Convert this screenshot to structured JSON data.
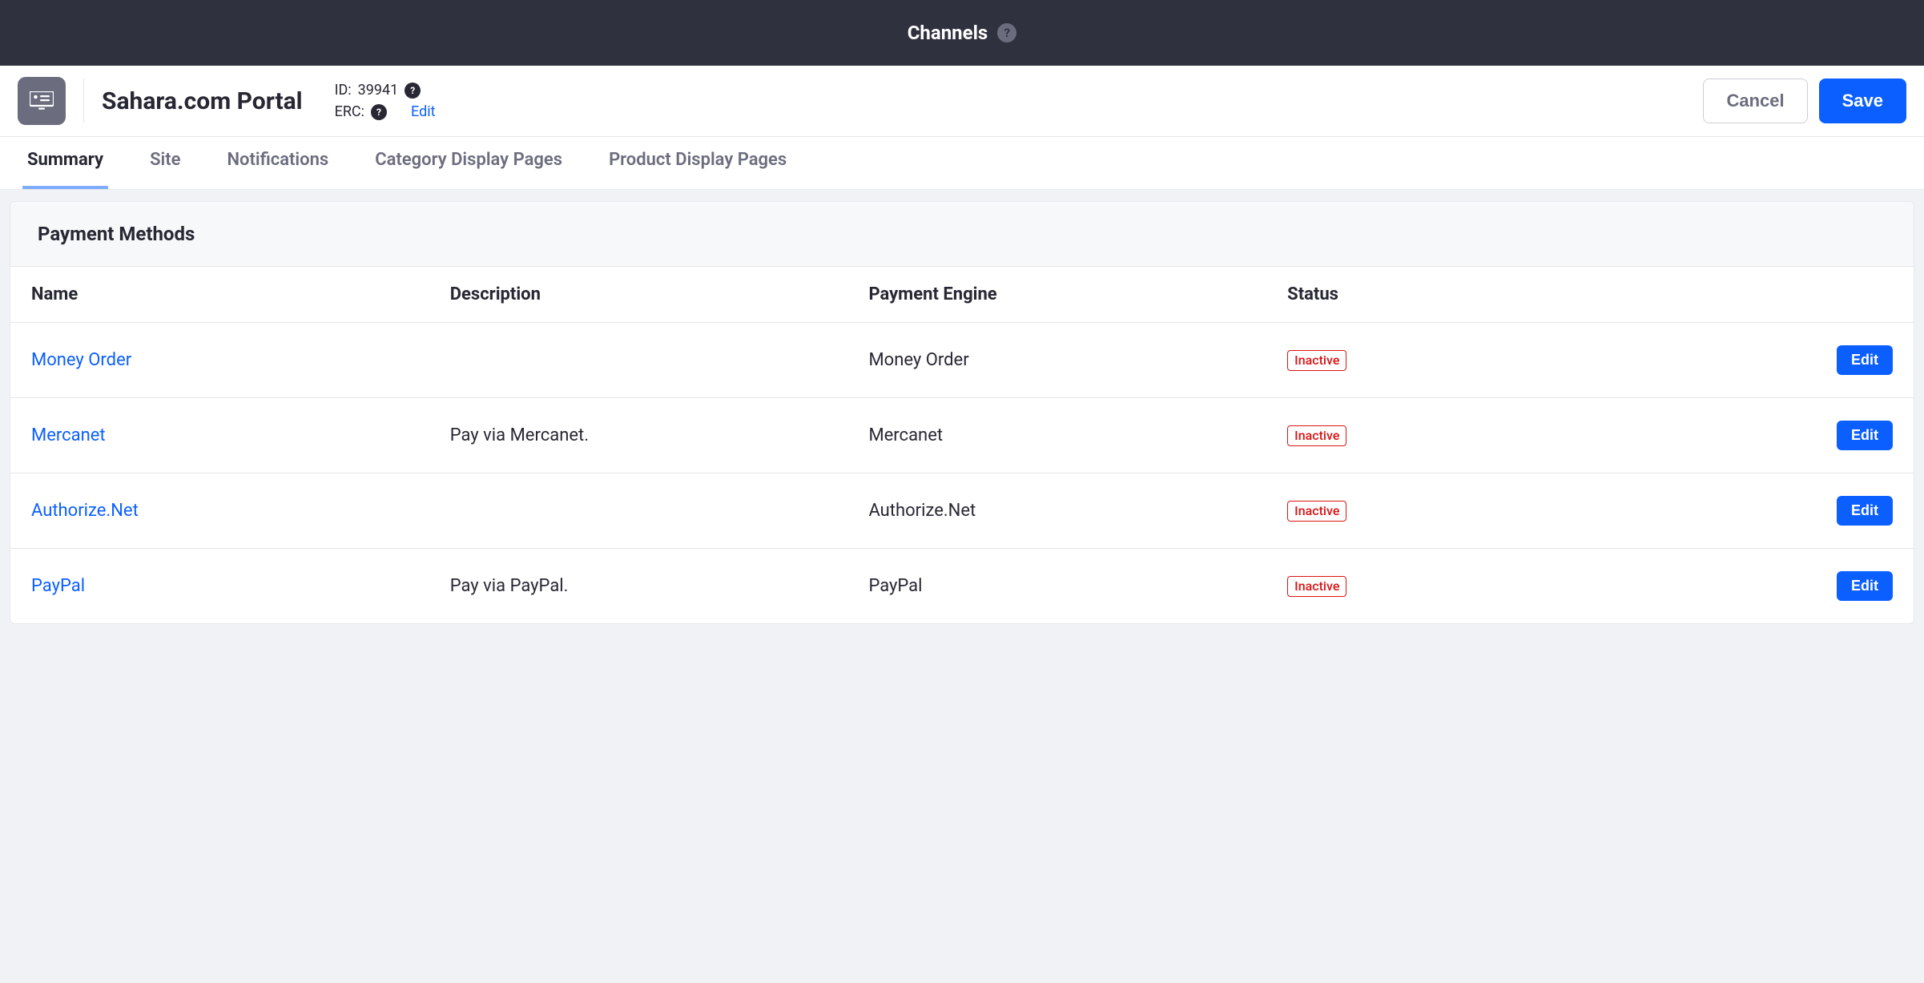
{
  "topbar": {
    "title": "Channels"
  },
  "header": {
    "title": "Sahara.com Portal",
    "id_label": "ID: ",
    "id_value": "39941",
    "erc_label": "ERC: ",
    "edit_link": "Edit",
    "cancel_label": "Cancel",
    "save_label": "Save"
  },
  "tabs": [
    {
      "label": "Summary",
      "active": true
    },
    {
      "label": "Site",
      "active": false
    },
    {
      "label": "Notifications",
      "active": false
    },
    {
      "label": "Category Display Pages",
      "active": false
    },
    {
      "label": "Product Display Pages",
      "active": false
    }
  ],
  "panel": {
    "title": "Payment Methods",
    "columns": {
      "name": "Name",
      "description": "Description",
      "engine": "Payment Engine",
      "status": "Status"
    },
    "edit_label": "Edit",
    "rows": [
      {
        "name": "Money Order",
        "description": "",
        "engine": "Money Order",
        "status": "Inactive"
      },
      {
        "name": "Mercanet",
        "description": "Pay via Mercanet.",
        "engine": "Mercanet",
        "status": "Inactive"
      },
      {
        "name": "Authorize.Net",
        "description": "",
        "engine": "Authorize.Net",
        "status": "Inactive"
      },
      {
        "name": "PayPal",
        "description": "Pay via PayPal.",
        "engine": "PayPal",
        "status": "Inactive"
      }
    ]
  }
}
